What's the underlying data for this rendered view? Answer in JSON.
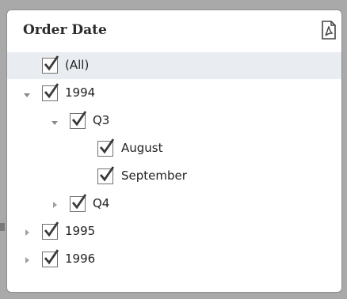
{
  "panel": {
    "title": "Order Date",
    "export_icon": "export-to-pdf-icon"
  },
  "tree": [
    {
      "label": "(All)",
      "checked": true,
      "expand": "none"
    },
    {
      "label": "1994",
      "checked": true,
      "expand": "expanded"
    },
    {
      "label": "Q3",
      "checked": true,
      "expand": "expanded"
    },
    {
      "label": "August",
      "checked": true,
      "expand": "none"
    },
    {
      "label": "September",
      "checked": true,
      "expand": "none"
    },
    {
      "label": "Q4",
      "checked": true,
      "expand": "collapsed"
    },
    {
      "label": "1995",
      "checked": true,
      "expand": "collapsed"
    },
    {
      "label": "1996",
      "checked": true,
      "expand": "collapsed"
    }
  ],
  "colors": {
    "highlight_row": "#e9edf2",
    "background": "#a9a9a9"
  }
}
